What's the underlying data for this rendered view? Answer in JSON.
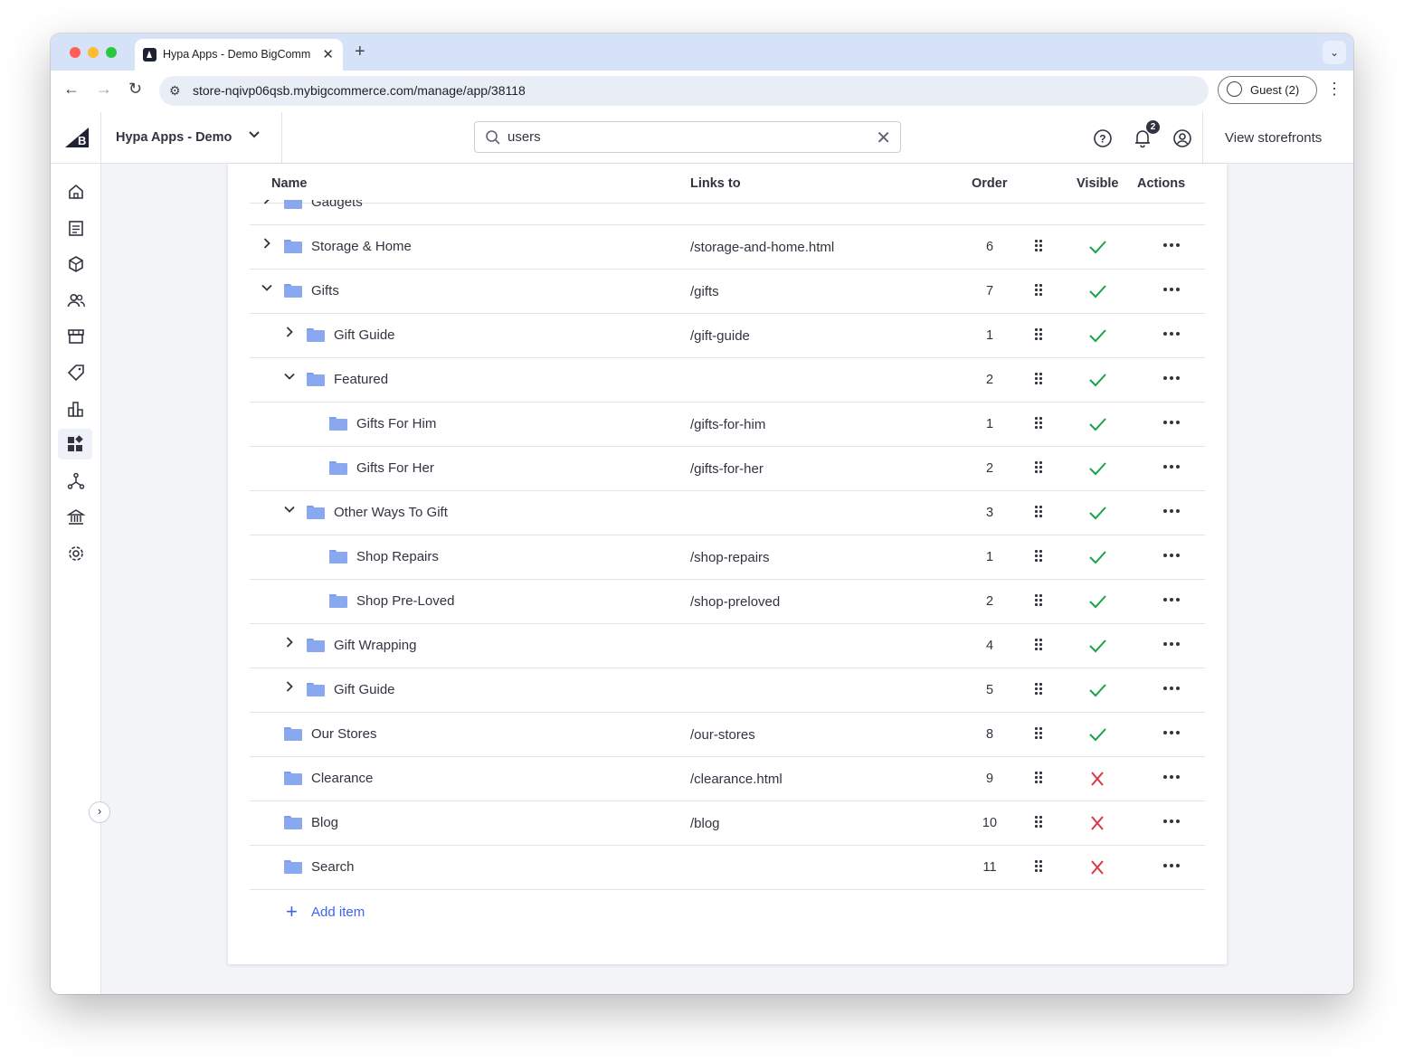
{
  "browser": {
    "tab_title": "Hypa Apps - Demo BigComm",
    "url": "store-nqivp06qsb.mybigcommerce.com/manage/app/38118",
    "profile_label": "Guest (2)"
  },
  "header": {
    "store_name": "Hypa Apps - Demo",
    "search_value": "users",
    "notification_count": "2",
    "view_storefronts_label": "View storefronts"
  },
  "table": {
    "columns": {
      "name": "Name",
      "links_to": "Links to",
      "order": "Order",
      "visible": "Visible",
      "actions": "Actions"
    },
    "partial_row_name": "Gadgets",
    "rows": [
      {
        "name": "Storage & Home",
        "link": "/storage-and-home.html",
        "order": "6",
        "visible": true,
        "depth": 0,
        "expander": "collapsed"
      },
      {
        "name": "Gifts",
        "link": "/gifts",
        "order": "7",
        "visible": true,
        "depth": 0,
        "expander": "expanded"
      },
      {
        "name": "Gift Guide",
        "link": "/gift-guide",
        "order": "1",
        "visible": true,
        "depth": 1,
        "expander": "collapsed"
      },
      {
        "name": "Featured",
        "link": "",
        "order": "2",
        "visible": true,
        "depth": 1,
        "expander": "expanded"
      },
      {
        "name": "Gifts For Him",
        "link": "/gifts-for-him",
        "order": "1",
        "visible": true,
        "depth": 2,
        "expander": "none"
      },
      {
        "name": "Gifts For Her",
        "link": "/gifts-for-her",
        "order": "2",
        "visible": true,
        "depth": 2,
        "expander": "none"
      },
      {
        "name": "Other Ways To Gift",
        "link": "",
        "order": "3",
        "visible": true,
        "depth": 1,
        "expander": "expanded"
      },
      {
        "name": "Shop Repairs",
        "link": "/shop-repairs",
        "order": "1",
        "visible": true,
        "depth": 2,
        "expander": "none"
      },
      {
        "name": "Shop Pre-Loved",
        "link": "/shop-preloved",
        "order": "2",
        "visible": true,
        "depth": 2,
        "expander": "none"
      },
      {
        "name": "Gift Wrapping",
        "link": "",
        "order": "4",
        "visible": true,
        "depth": 1,
        "expander": "collapsed"
      },
      {
        "name": "Gift Guide",
        "link": "",
        "order": "5",
        "visible": true,
        "depth": 1,
        "expander": "collapsed"
      },
      {
        "name": "Our Stores",
        "link": "/our-stores",
        "order": "8",
        "visible": true,
        "depth": 0,
        "expander": "none"
      },
      {
        "name": "Clearance",
        "link": "/clearance.html",
        "order": "9",
        "visible": false,
        "depth": 0,
        "expander": "none"
      },
      {
        "name": "Blog",
        "link": "/blog",
        "order": "10",
        "visible": false,
        "depth": 0,
        "expander": "none"
      },
      {
        "name": "Search",
        "link": "",
        "order": "11",
        "visible": false,
        "depth": 0,
        "expander": "none"
      }
    ],
    "add_item_label": "Add item"
  },
  "sidebar": {
    "items": [
      "home-icon",
      "orders-icon",
      "products-icon",
      "customers-icon",
      "storefront-icon",
      "marketing-icon",
      "analytics-icon",
      "apps-icon",
      "channels-icon",
      "finance-icon",
      "settings-icon"
    ],
    "active": "apps-icon"
  },
  "colors": {
    "accent": "#3c64f4",
    "visible_check": "#1aa24b",
    "hidden_cross": "#db3643",
    "folder": "#8aa8f0",
    "text": "#313440"
  }
}
